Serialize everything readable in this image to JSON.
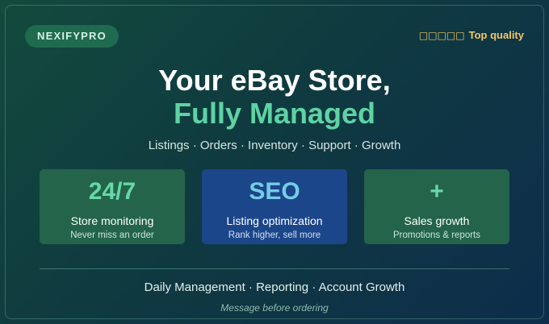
{
  "brand": {
    "name": "NEXIFYPRO"
  },
  "quality": {
    "stars": "□□□□□",
    "label": "Top quality"
  },
  "headline": {
    "line1": "Your eBay Store,",
    "line2": "Fully Managed"
  },
  "subline": "Listings · Orders · Inventory · Support · Growth",
  "cards": [
    {
      "big": "24/7",
      "title": "Store monitoring",
      "subtitle": "Never miss an order"
    },
    {
      "big": "SEO",
      "title": "Listing optimization",
      "subtitle": "Rank higher, sell more"
    },
    {
      "big": "+",
      "title": "Sales growth",
      "subtitle": "Promotions & reports"
    }
  ],
  "footer": {
    "main": "Daily Management · Reporting · Account Growth",
    "note": "Message before ordering"
  },
  "colors": {
    "accent_green": "#5fd3a3",
    "accent_gold": "#f2c56b",
    "card_green": "#23644a",
    "card_blue": "#1b4689"
  }
}
